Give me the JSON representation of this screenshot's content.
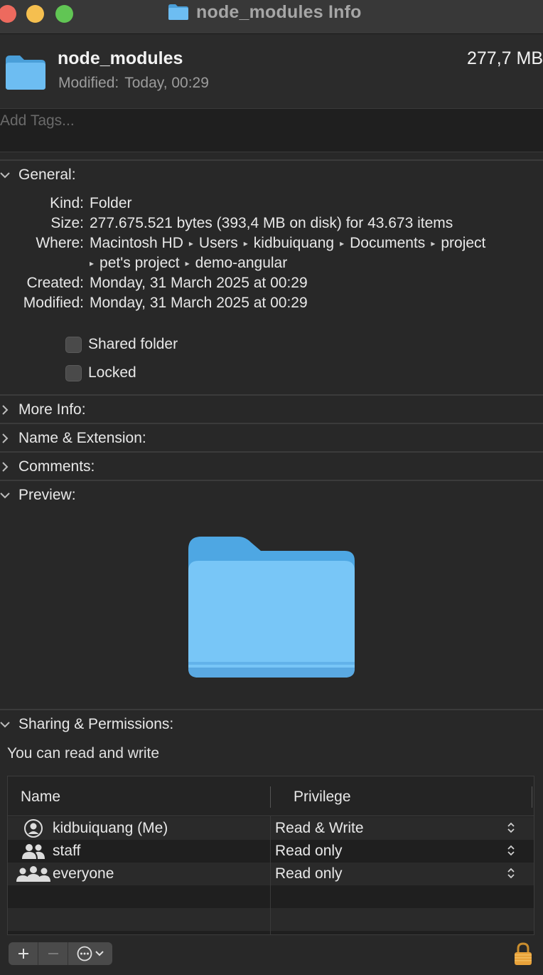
{
  "window": {
    "title": "node_modules Info"
  },
  "header": {
    "name": "node_modules",
    "size": "277,7 MB",
    "modified_label": "Modified:",
    "modified_value": "Today, 00:29"
  },
  "tags": {
    "placeholder": "Add Tags..."
  },
  "sections": {
    "general": "General:",
    "more_info": "More Info:",
    "name_extension": "Name & Extension:",
    "comments": "Comments:",
    "preview": "Preview:",
    "sharing": "Sharing & Permissions:"
  },
  "general": {
    "kind_label": "Kind:",
    "kind_value": "Folder",
    "size_label": "Size:",
    "size_value": "277.675.521 bytes (393,4 MB on disk) for 43.673 items",
    "where_label": "Where:",
    "where_path": [
      "Macintosh HD",
      "Users",
      "kidbuiquang",
      "Documents",
      "project",
      "pet's project",
      "demo-angular"
    ],
    "created_label": "Created:",
    "created_value": "Monday, 31 March 2025 at 00:29",
    "modified_label": "Modified:",
    "modified_value": "Monday, 31 March 2025 at 00:29",
    "shared_folder_label": "Shared folder",
    "shared_folder_checked": false,
    "locked_label": "Locked",
    "locked_checked": false
  },
  "sharing": {
    "note": "You can read and write",
    "columns": {
      "name": "Name",
      "privilege": "Privilege"
    },
    "rows": [
      {
        "name": "kidbuiquang (Me)",
        "privilege": "Read & Write",
        "icon": "single-user-icon"
      },
      {
        "name": "staff",
        "privilege": "Read only",
        "icon": "group-icon"
      },
      {
        "name": "everyone",
        "privilege": "Read only",
        "icon": "everyone-icon"
      }
    ]
  },
  "toolbar": {
    "add": "add-icon",
    "remove": "remove-icon",
    "action": "ellipsis-circle-icon",
    "lock": "padlock-icon"
  },
  "colors": {
    "folder_blue": "#5fb4ee",
    "lock_gold": "#e8a23a"
  }
}
